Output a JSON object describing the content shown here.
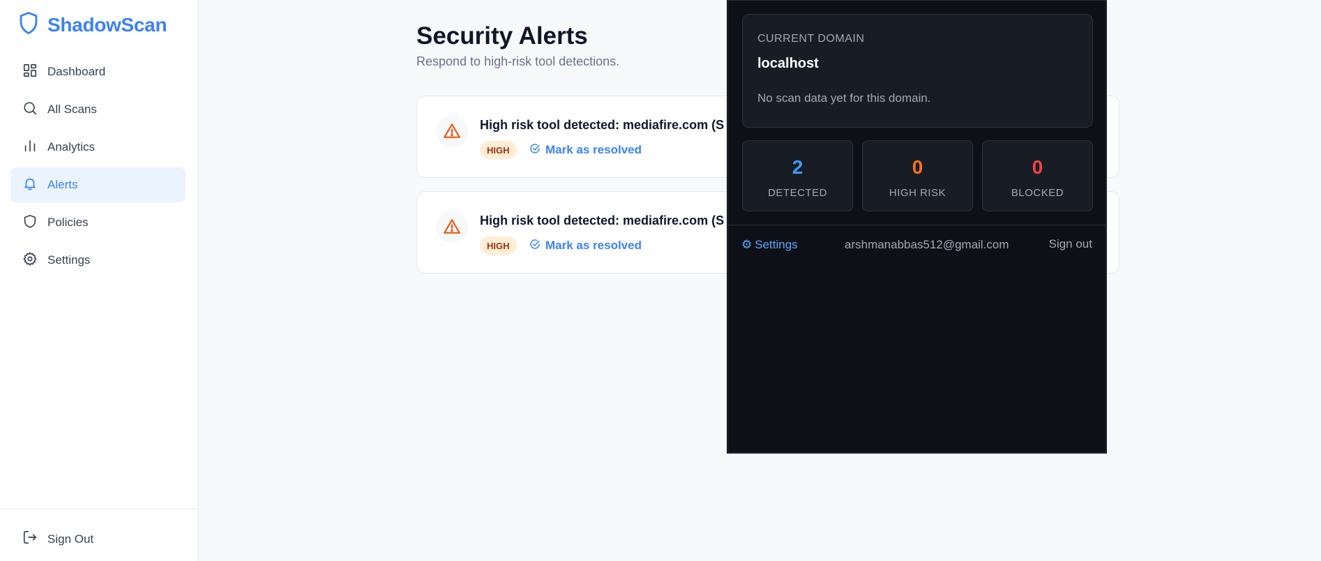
{
  "brand": {
    "name": "ShadowScan",
    "icon": "shield-icon",
    "color": "#3b82f6"
  },
  "sidebar": {
    "items": [
      {
        "label": "Dashboard",
        "icon": "dashboard-icon"
      },
      {
        "label": "All Scans",
        "icon": "search-icon"
      },
      {
        "label": "Analytics",
        "icon": "bar-chart-icon"
      },
      {
        "label": "Alerts",
        "icon": "bell-icon",
        "active": true
      },
      {
        "label": "Policies",
        "icon": "shield-icon"
      },
      {
        "label": "Settings",
        "icon": "gear-icon"
      }
    ],
    "sign_out": {
      "label": "Sign Out",
      "icon": "logout-icon"
    }
  },
  "main": {
    "title": "Security Alerts",
    "subtitle": "Respond to high-risk tool detections.",
    "alerts": [
      {
        "title": "High risk tool detected: mediafire.com (S",
        "severity": "HIGH",
        "action": "Mark as resolved",
        "icon": "warning-icon"
      },
      {
        "title": "High risk tool detected: mediafire.com (S",
        "severity": "HIGH",
        "action": "Mark as resolved",
        "icon": "warning-icon"
      }
    ]
  },
  "popup": {
    "domain_label": "CURRENT DOMAIN",
    "domain": "localhost",
    "message": "No scan data yet for this domain.",
    "stats": [
      {
        "value": "2",
        "label": "DETECTED",
        "color": "#3b9cf6"
      },
      {
        "value": "0",
        "label": "HIGH RISK",
        "color": "#f97316"
      },
      {
        "value": "0",
        "label": "BLOCKED",
        "color": "#ef4444"
      }
    ],
    "footer": {
      "settings_icon": "⚙",
      "settings_label": "Settings",
      "email": "arshmanabbas512@gmail.com",
      "sign_out": "Sign out"
    }
  }
}
